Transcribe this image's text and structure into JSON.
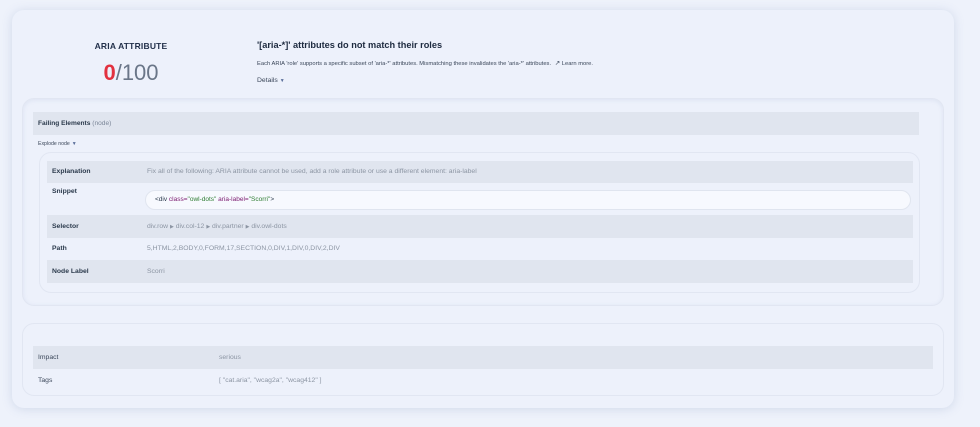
{
  "score": {
    "title": "ARIA ATTRIBUTE",
    "value": "0",
    "max": "/100",
    "value_color": "#e2313f"
  },
  "issue": {
    "title": "'[aria-*]' attributes do not match their roles",
    "description": "Each ARIA 'role' supports a specific subset of 'aria-*' attributes. Mismatching these invalidates the 'aria-*' attributes.",
    "learn_more": "Learn more.",
    "details_label": "Details"
  },
  "failing": {
    "title": "Failing Elements",
    "subtitle": "(node)",
    "explode_label": "Explode node",
    "rows": {
      "explanation_label": "Explanation",
      "explanation_value": "Fix all of the following: ARIA attribute cannot be used, add a role attribute or use a different element: aria-label",
      "snippet_label": "Snippet",
      "snippet_tag_open": "<div ",
      "snippet_attr1_name": "class=",
      "snippet_attr1_value": "\"owl-dots\"",
      "snippet_attr2_name": "aria-label=",
      "snippet_attr2_value": "\"Scorri\"",
      "snippet_tag_close": ">",
      "selector_label": "Selector",
      "selector_parts": [
        "div.row",
        "div.col-12",
        "div.partner",
        "div.owl-dots"
      ],
      "path_label": "Path",
      "path_value": "5,HTML,2,BODY,0,FORM,17,SECTION,0,DIV,1,DIV,0,DIV,2,DIV",
      "node_label_label": "Node Label",
      "node_label_value": "Scorri"
    }
  },
  "impact": {
    "impact_label": "Impact",
    "impact_value": "serious",
    "tags_label": "Tags",
    "tags_value": "[ \"cat.aria\", \"wcag2a\", \"wcag412\" ]"
  }
}
